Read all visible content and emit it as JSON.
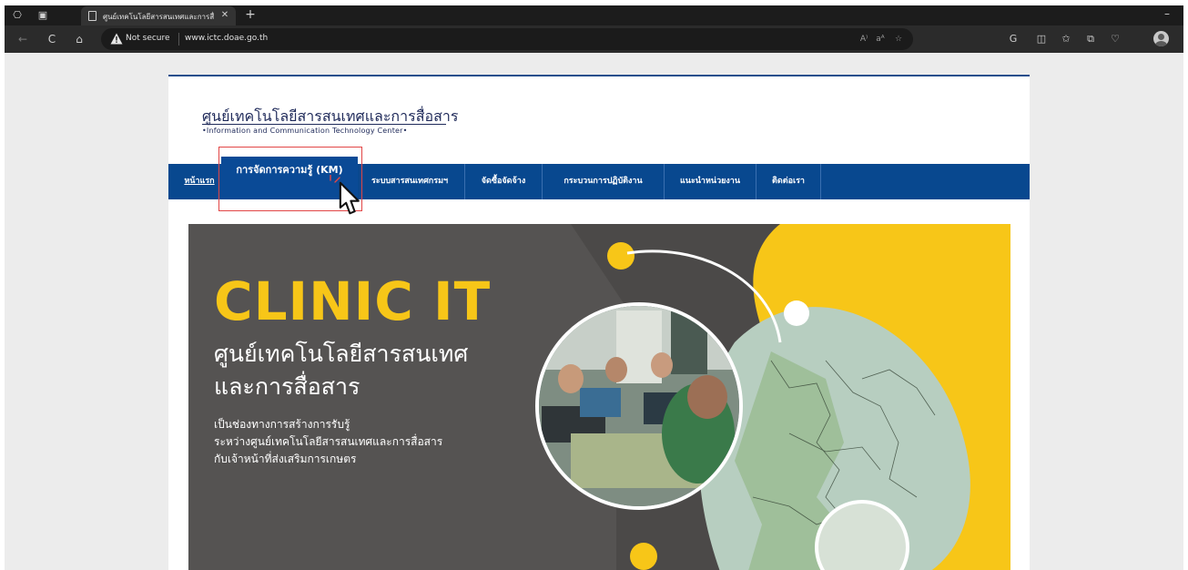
{
  "browser": {
    "tab_title": "ศูนย์เทคโนโลยีสารสนเทศและการสื่อสาร",
    "address": {
      "security_label": "Not secure",
      "url": "www.ictc.doae.go.th"
    },
    "icons": {
      "back": "←",
      "refresh": "C",
      "home": "⌂",
      "read_aloud": "A⁾",
      "translate": "aᴬ",
      "favorite": "☆",
      "copilot": "G",
      "split": "◫",
      "favorites_bar": "✩",
      "collections": "⧉",
      "browser_essentials": "♡"
    }
  },
  "site": {
    "logo_thai": "ศูนย์เทคโนโลยีสารสนเทศและการสื่อสาร",
    "logo_english": "•Information and Communication Technology Center•",
    "nav": {
      "home": "หน้าแรก",
      "km": "การจัดการความรู้ (KM)",
      "info_systems": "ระบบสารสนเทศกรมฯ",
      "procurement": "จัดซื้อจัดจ้าง",
      "work_process": "กระบวนการปฏิบัติงาน",
      "units": "แนะนำหน่วยงาน",
      "contact": "ติดต่อเรา"
    }
  },
  "banner": {
    "title": "CLINIC IT",
    "subtitle_line1": "ศูนย์เทคโนโลยีสารสนเทศ",
    "subtitle_line2": "และการสื่อสาร",
    "desc_line1": "เป็นช่องทางการสร้างการรับรู้",
    "desc_line2": "ระหว่างศูนย์เทคโนโลยีสารสนเทศและการสื่อสาร",
    "desc_line3": "กับเจ้าหน้าที่ส่งเสริมการเกษตร"
  },
  "colors": {
    "nav_blue": "#08488f",
    "banner_yellow": "#f7c618",
    "banner_gray": "#4b4948",
    "highlight_red": "#e24646"
  }
}
